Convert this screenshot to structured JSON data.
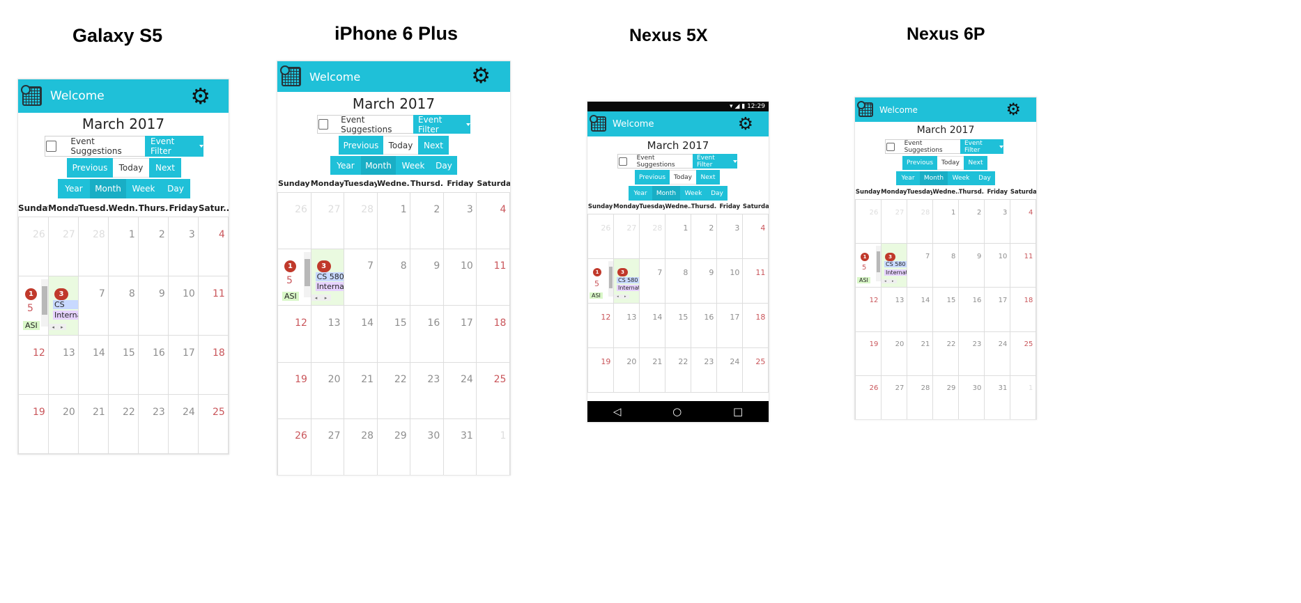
{
  "devices": [
    {
      "title": "Galaxy S5"
    },
    {
      "title": "iPhone 6 Plus"
    },
    {
      "title": "Nexus 5X"
    },
    {
      "title": "Nexus 6P"
    }
  ],
  "status_bar": {
    "time": "12:29"
  },
  "app": {
    "welcome": "Welcome",
    "month_title": "March 2017",
    "event_suggestions": "Event Suggestions",
    "event_filter": "Event Filter",
    "nav_buttons": [
      "Previous",
      "Today",
      "Next"
    ],
    "view_buttons": [
      "Year",
      "Month",
      "Week",
      "Day"
    ],
    "active_view": "Month"
  },
  "day_headers": {
    "galaxy": [
      "Sunday",
      "Monday",
      "Tuesd...",
      "Wedn...",
      "Thurs...",
      "Friday",
      "Satur..."
    ],
    "iphone": [
      "Sunday",
      "Monday",
      "Tuesday",
      "Wedne...",
      "Thursd...",
      "Friday",
      "Saturday"
    ],
    "nexus5x": [
      "Sunday",
      "Monday",
      "Tuesday",
      "Wedne...",
      "Thursd...",
      "Friday",
      "Saturday"
    ],
    "nexus6p": [
      "Sunday",
      "Monday",
      "Tuesday",
      "Wedne...",
      "Thursd...",
      "Friday",
      "Saturday"
    ]
  },
  "weeks_4": [
    [
      "26",
      "27",
      "28",
      "1",
      "2",
      "3",
      "4"
    ],
    [
      "",
      "",
      "7",
      "8",
      "9",
      "10",
      "11"
    ],
    [
      "12",
      "13",
      "14",
      "15",
      "16",
      "17",
      "18"
    ],
    [
      "19",
      "20",
      "21",
      "22",
      "23",
      "24",
      "25"
    ]
  ],
  "weeks_5": [
    [
      "26",
      "27",
      "28",
      "1",
      "2",
      "3",
      "4"
    ],
    [
      "",
      "",
      "7",
      "8",
      "9",
      "10",
      "11"
    ],
    [
      "12",
      "13",
      "14",
      "15",
      "16",
      "17",
      "18"
    ],
    [
      "19",
      "20",
      "21",
      "22",
      "23",
      "24",
      "25"
    ],
    [
      "26",
      "27",
      "28",
      "29",
      "30",
      "31",
      "1"
    ]
  ],
  "events": {
    "sunday_badge": "1",
    "sunday_number": "5",
    "sunday_event": "ASI",
    "monday_badge": "3",
    "galaxy_monday_event_1": "CS",
    "monday_event_1": "CS 580",
    "monday_event_2": "Internat"
  },
  "colors": {
    "accent": "#1fc0d8",
    "weekend": "#c9555a",
    "badge": "#c0392b"
  }
}
